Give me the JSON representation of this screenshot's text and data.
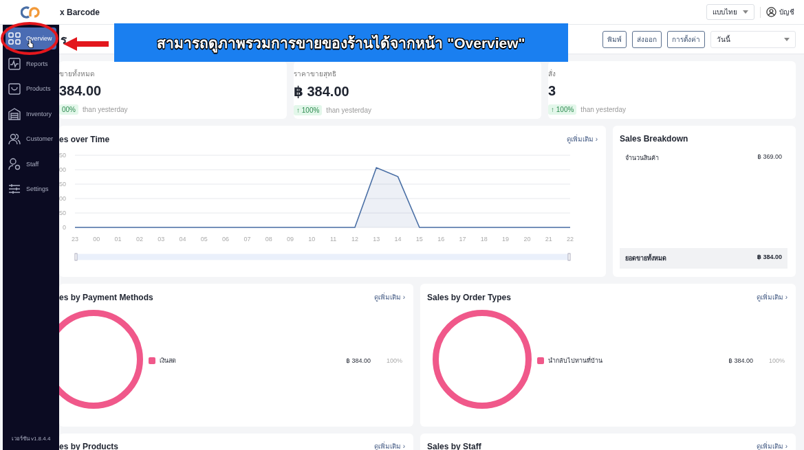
{
  "header": {
    "app_name": "x Barcode",
    "language": "แบบไทย",
    "account": "บัญชี"
  },
  "sidebar": {
    "items": [
      {
        "label": "Overview",
        "selected": true
      },
      {
        "label": "Reports",
        "selected": false
      },
      {
        "label": "Products",
        "selected": false
      },
      {
        "label": "Inventory",
        "selected": false
      },
      {
        "label": "Customer",
        "selected": false
      },
      {
        "label": "Staff",
        "selected": false
      },
      {
        "label": "Settings",
        "selected": false
      }
    ],
    "version": "เวอร์ชัน v1.8.4.4"
  },
  "toolbar": {
    "title": "ร",
    "buttons": [
      "พิมพ์",
      "ส่งออก",
      "การตั้งค่า"
    ],
    "period": "วันนี้"
  },
  "stats": [
    {
      "label": "ขายทั้งหมด",
      "value": "384.00",
      "change": "00%",
      "note": "than yesterday"
    },
    {
      "label": "ราคาขายสุทธิ",
      "value": "฿ 384.00",
      "change": "↑ 100%",
      "note": "than yesterday"
    },
    {
      "label": "สั่ง",
      "value": "3",
      "change": "↑ 100%",
      "note": "than yesterday"
    }
  ],
  "sales_over_time": {
    "title": "es over Time",
    "link": "ดูเพิ่มเติม ›",
    "y_tick_labels": [
      "50",
      "00",
      "50",
      "00",
      "50",
      "0"
    ],
    "zoom_slider": {
      "level": 1
    },
    "x_tick_labels": [
      "23",
      "00",
      "01",
      "02",
      "03",
      "04",
      "05",
      "06",
      "07",
      "08",
      "09",
      "10",
      "11",
      "12",
      "13",
      "14",
      "15",
      "16",
      "17",
      "18",
      "19",
      "20",
      "21",
      "22"
    ]
  },
  "breakdown": {
    "title": "Sales Breakdown",
    "rows": [
      {
        "label": "จำนวนสินค้า",
        "amount": "฿ 369.00"
      }
    ],
    "total": {
      "label": "ยอดขายทั้งหมด",
      "amount": "฿ 384.00"
    }
  },
  "donuts": [
    {
      "title": "es by Payment Methods",
      "link": "ดูเพิ่มเติม ›",
      "legend": [
        {
          "label": "เงินสด",
          "amount": "฿ 384.00",
          "percent": "100%",
          "color": "#f0588a"
        }
      ]
    },
    {
      "title": "Sales by Order Types",
      "link": "ดูเพิ่มเติม ›",
      "legend": [
        {
          "label": "นำกลับไปทานที่บ้าน",
          "amount": "฿ 384.00",
          "percent": "100%",
          "color": "#f0588a"
        }
      ]
    }
  ],
  "bottom_cards": [
    {
      "title": "es by Products",
      "link": "ดูเพิ่มเติม ›"
    },
    {
      "title": "Sales by Staff",
      "link": "ดูเพิ่มเติม ›"
    }
  ],
  "annotation": {
    "caption": "สามารถดูภาพรวมการขายของร้านได้จากหน้า \"Overview\""
  }
}
